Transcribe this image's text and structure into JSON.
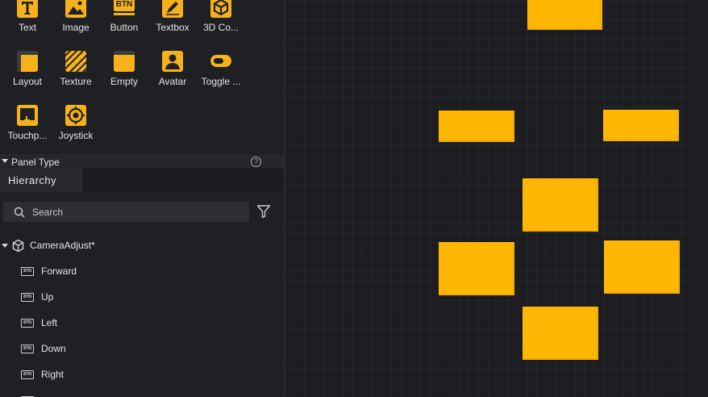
{
  "widgets": [
    {
      "label": "Text",
      "icon": "text-icon"
    },
    {
      "label": "Image",
      "icon": "image-icon"
    },
    {
      "label": "Button",
      "icon": "button-icon",
      "icon_text": "BTN"
    },
    {
      "label": "Textbox",
      "icon": "textbox-icon"
    },
    {
      "label": "3D Co...",
      "icon": "cube-icon"
    },
    {
      "label": "Layout",
      "icon": "layout-icon"
    },
    {
      "label": "Texture",
      "icon": "texture-icon"
    },
    {
      "label": "Empty",
      "icon": "empty-icon"
    },
    {
      "label": "Avatar",
      "icon": "avatar-icon"
    },
    {
      "label": "Toggle ...",
      "icon": "toggle-icon"
    },
    {
      "label": "Touchp...",
      "icon": "touchpad-icon"
    },
    {
      "label": "Joystick",
      "icon": "joystick-icon"
    }
  ],
  "panel_type": {
    "label": "Panel Type",
    "help_glyph": "?"
  },
  "hierarchy": {
    "tab_label": "Hierarchy",
    "search_placeholder": "Search",
    "root": {
      "label": "CameraAdjust*",
      "icon": "cube-outline-icon"
    },
    "button_icon_text": "BTN",
    "items": [
      "Forward",
      "Up",
      "Left",
      "Down",
      "Right"
    ]
  },
  "canvas": {
    "block_color": "#ffb703",
    "grid_bg": "#1c1d21"
  },
  "colors": {
    "accent": "#f5b21a",
    "panel_bg": "#1f2024"
  }
}
